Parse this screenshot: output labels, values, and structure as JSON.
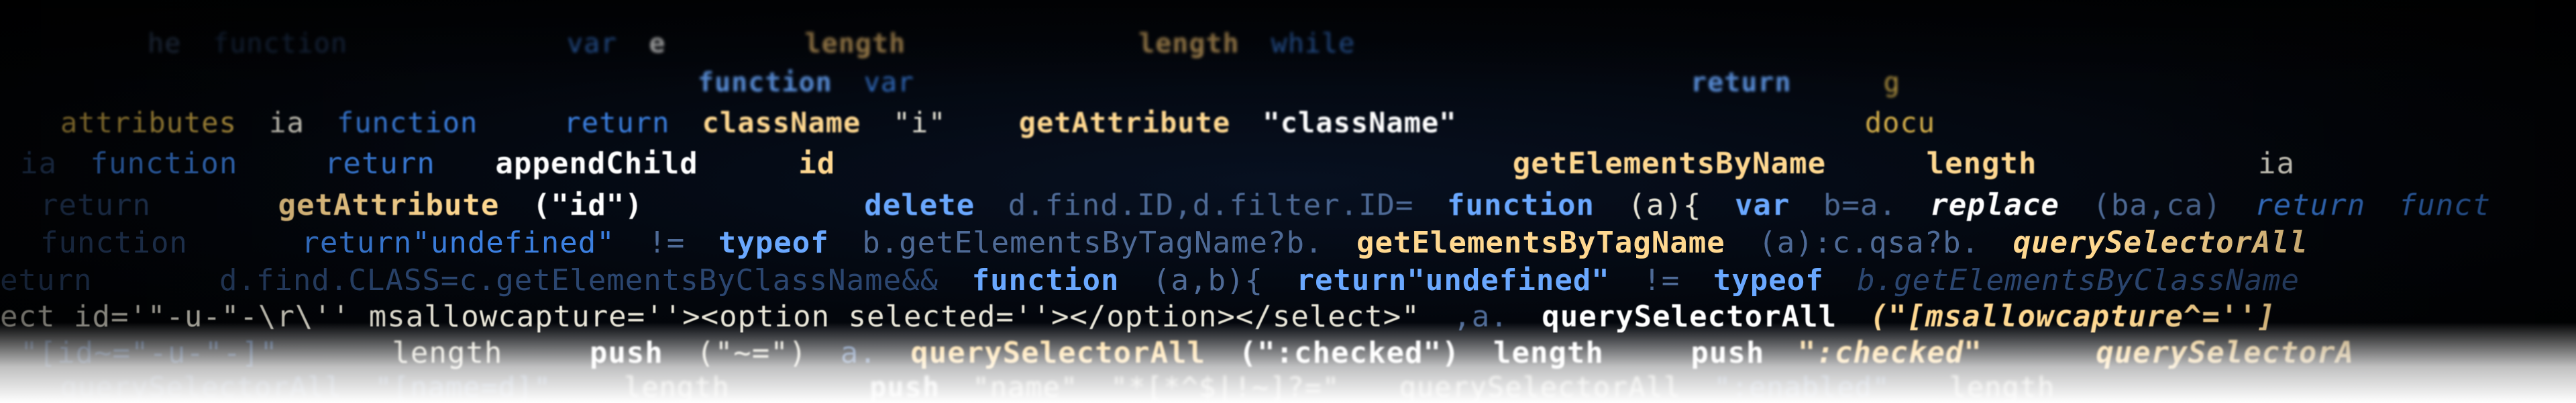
{
  "code_lines": [
    [
      "he",
      "function",
      "var",
      "e",
      "length",
      "length",
      "while"
    ],
    [
      "function",
      "var",
      "return",
      "g"
    ],
    [
      "attributes",
      "ia",
      "function",
      "return",
      "className",
      "\"i\"",
      "getAttribute",
      "\"className\"",
      "docu"
    ],
    [
      "ia",
      "function",
      "return",
      "appendChild",
      "id",
      "getElementsByName",
      "length",
      "ia"
    ],
    [
      "return",
      "getAttribute",
      "(\"id\")",
      "delete",
      "d.find.ID,d.filter.ID=",
      "function",
      "(a){",
      "var",
      "b=a.",
      "replace",
      "(ba,ca)",
      "return",
      "funct"
    ],
    [
      "function",
      "return\"undefined\"",
      "!=",
      "typeof",
      "b.getElementsByTagName?b.",
      "getElementsByTagName",
      "(a):c.qsa?b.",
      "querySelectorAll"
    ],
    [
      "eturn",
      "d.find.CLASS=c.getElementsByClassName&&",
      "function",
      "(a,b){",
      "return\"undefined\"",
      "!=",
      "typeof",
      "b.getElementsByClassName"
    ],
    [
      "ect id='\"-u-\"-\\r\\'' msallowcapture=''><option selected=''></option></select>\"",
      ",a.",
      "querySelectorAll",
      "(\"[msallowcapture^='']"
    ],
    [
      "\"[id~=\"-u-\"-]\"",
      "length",
      "push",
      "(\"~=\")",
      "a.",
      "querySelectorAll",
      "(\":checked\")",
      "length",
      "push",
      "\":checked\"",
      "querySelectorA"
    ],
    [
      "querySelectorAll",
      "\"[name=d]\"",
      "length",
      "push",
      "\"name\"",
      "\"*[*^$|!~]?=\"",
      "querySelectorAll",
      "\":enabled\"",
      "length"
    ]
  ]
}
